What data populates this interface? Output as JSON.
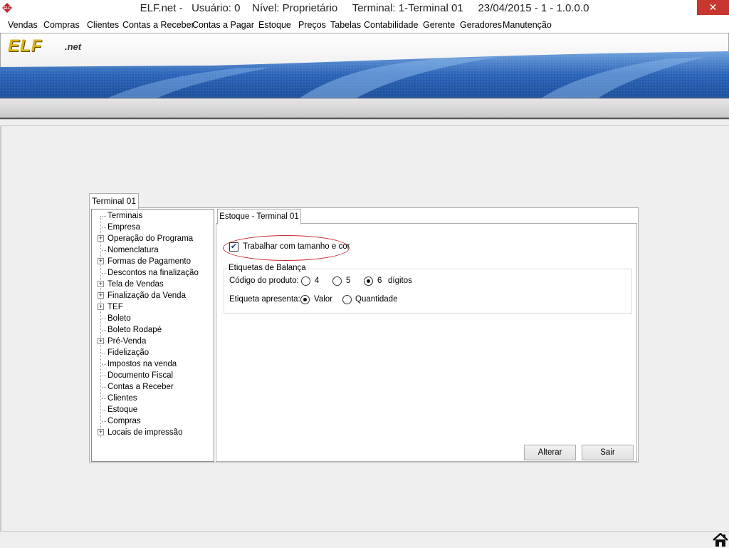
{
  "window": {
    "title": "ELF.net -   Usuário: 0    Nível: Proprietário     Terminal: 1-Terminal 01     23/04/2015 - 1 - 1.0.0.0",
    "close_glyph": "✕"
  },
  "menu": [
    "Vendas",
    "Compras",
    "Clientes",
    "Contas a Receber",
    "Contas a Pagar",
    "Estoque",
    "Preços",
    "Tabelas",
    "Contabilidade",
    "Gerente",
    "Geradores",
    "Manutenção"
  ],
  "banner": {
    "logo": "ELF",
    "logo_suffix": ".net"
  },
  "outer_tab": "Terminal 01",
  "tree": [
    {
      "label": "Terminais",
      "expandable": false
    },
    {
      "label": "Empresa",
      "expandable": false
    },
    {
      "label": "Operação do Programa",
      "expandable": true
    },
    {
      "label": "Nomenclatura",
      "expandable": false
    },
    {
      "label": "Formas de Pagamento",
      "expandable": true
    },
    {
      "label": "Descontos na finalização",
      "expandable": false
    },
    {
      "label": "Tela de Vendas",
      "expandable": true
    },
    {
      "label": "Finalização da Venda",
      "expandable": true
    },
    {
      "label": "TEF",
      "expandable": true
    },
    {
      "label": "Boleto",
      "expandable": false
    },
    {
      "label": "Boleto Rodapé",
      "expandable": false
    },
    {
      "label": "Pré-Venda",
      "expandable": true
    },
    {
      "label": "Fidelização",
      "expandable": false
    },
    {
      "label": "Impostos na venda",
      "expandable": false
    },
    {
      "label": "Documento Fiscal",
      "expandable": false
    },
    {
      "label": "Contas a Receber",
      "expandable": false
    },
    {
      "label": "Clientes",
      "expandable": false
    },
    {
      "label": "Estoque",
      "expandable": false
    },
    {
      "label": "Compras",
      "expandable": false
    },
    {
      "label": "Locais de impressão",
      "expandable": true
    }
  ],
  "inner_tab": "Estoque - Terminal 01",
  "settings": {
    "size_color_checkbox": {
      "label": "Trabalhar com tamanho e cor",
      "checked": true,
      "check_glyph": "✔"
    },
    "scale_group": {
      "title": "Etiquetas de Balança",
      "product_code": {
        "label": "Código do produto:",
        "options": [
          "4",
          "5",
          "6"
        ],
        "selected": "6",
        "suffix": "dígitos"
      },
      "label_shows": {
        "label": "Etiqueta apresenta:",
        "options": [
          "Valor",
          "Quantidade"
        ],
        "selected": "Valor"
      }
    }
  },
  "buttons": {
    "alter": "Alterar",
    "exit": "Sair"
  },
  "colors": {
    "close": "#c7372f",
    "highlight_ellipse": "#c7262a",
    "banner_blue": "#2a64b8",
    "logo_gold": "#d9b21a"
  }
}
